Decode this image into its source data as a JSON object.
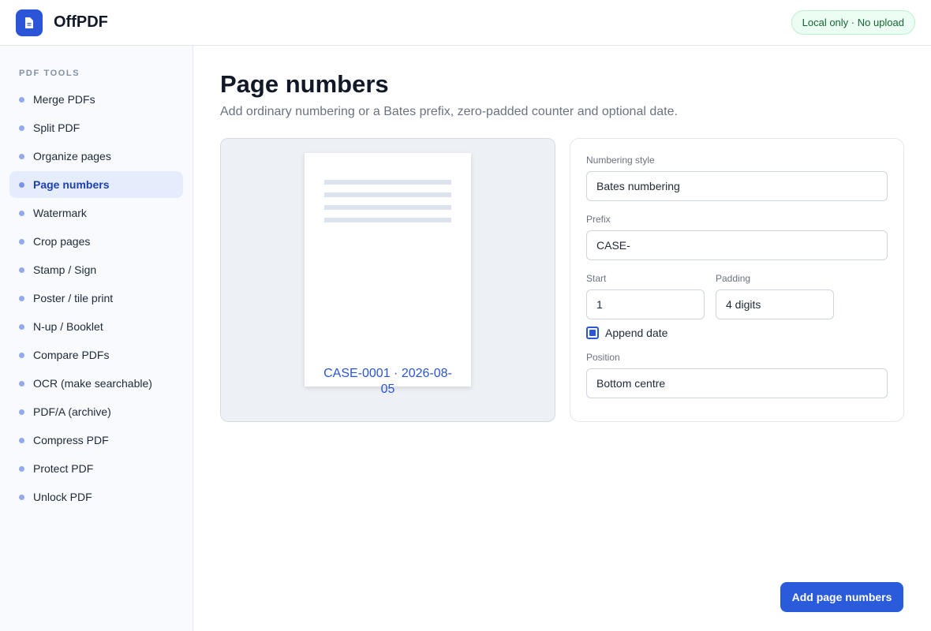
{
  "app": {
    "title": "OffPDF",
    "logo_icon": "document-icon",
    "badge": "Local only · No upload",
    "accent_color": "#2a55d6"
  },
  "sidebar": {
    "heading": "PDF TOOLS",
    "items": [
      {
        "label": "Merge PDFs"
      },
      {
        "label": "Split PDF"
      },
      {
        "label": "Organize pages"
      },
      {
        "label": "Page numbers",
        "active": true
      },
      {
        "label": "Watermark"
      },
      {
        "label": "Crop pages"
      },
      {
        "label": "Stamp / Sign"
      },
      {
        "label": "Poster / tile print"
      },
      {
        "label": "N-up / Booklet"
      },
      {
        "label": "Compare PDFs"
      },
      {
        "label": "OCR (make searchable)"
      },
      {
        "label": "PDF/A (archive)"
      },
      {
        "label": "Compress PDF"
      },
      {
        "label": "Protect PDF"
      },
      {
        "label": "Unlock PDF"
      }
    ]
  },
  "main": {
    "title": "Page numbers",
    "subtitle": "Add ordinary numbering or a Bates prefix, zero-padded counter and optional date.",
    "preview": {
      "stamp_text": "CASE-0001 · 2026-08-05"
    },
    "form": {
      "numbering_style": {
        "label": "Numbering style",
        "value": "Bates numbering"
      },
      "prefix": {
        "label": "Prefix",
        "value": "CASE-"
      },
      "start": {
        "label": "Start",
        "value": "1"
      },
      "padding": {
        "label": "Padding",
        "value": "4 digits"
      },
      "append_date": {
        "label": "Append date",
        "checked": true
      },
      "position": {
        "label": "Position",
        "value": "Bottom centre"
      }
    },
    "submit_label": "Add page numbers"
  }
}
